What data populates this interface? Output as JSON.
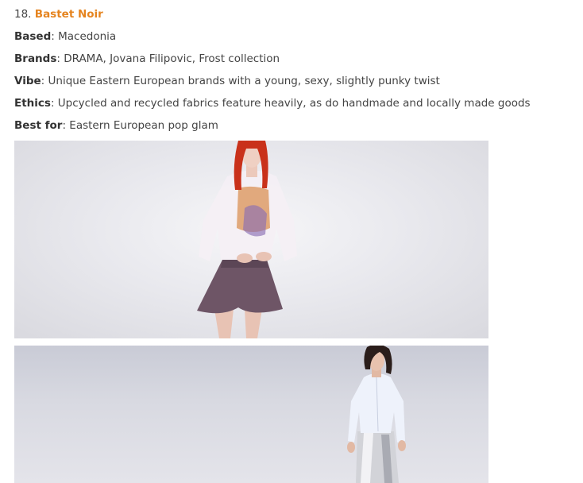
{
  "entry": {
    "number": "18.",
    "title": "Bastet Noir"
  },
  "details": [
    {
      "label": "Based",
      "value": ": Macedonia"
    },
    {
      "label": "Brands",
      "value": ": DRAMA, Jovana Filipovic, Frost collection"
    },
    {
      "label": "Vibe",
      "value": ": Unique Eastern European brands with a young, sexy, slightly punky twist"
    },
    {
      "label": "Ethics",
      "value": ": Upcycled and recycled fabrics feature heavily, as do handmade and locally made goods"
    },
    {
      "label": "Best for",
      "value": ": Eastern European pop glam"
    }
  ],
  "colors": {
    "link": "#e5841f",
    "text": "#444444"
  }
}
